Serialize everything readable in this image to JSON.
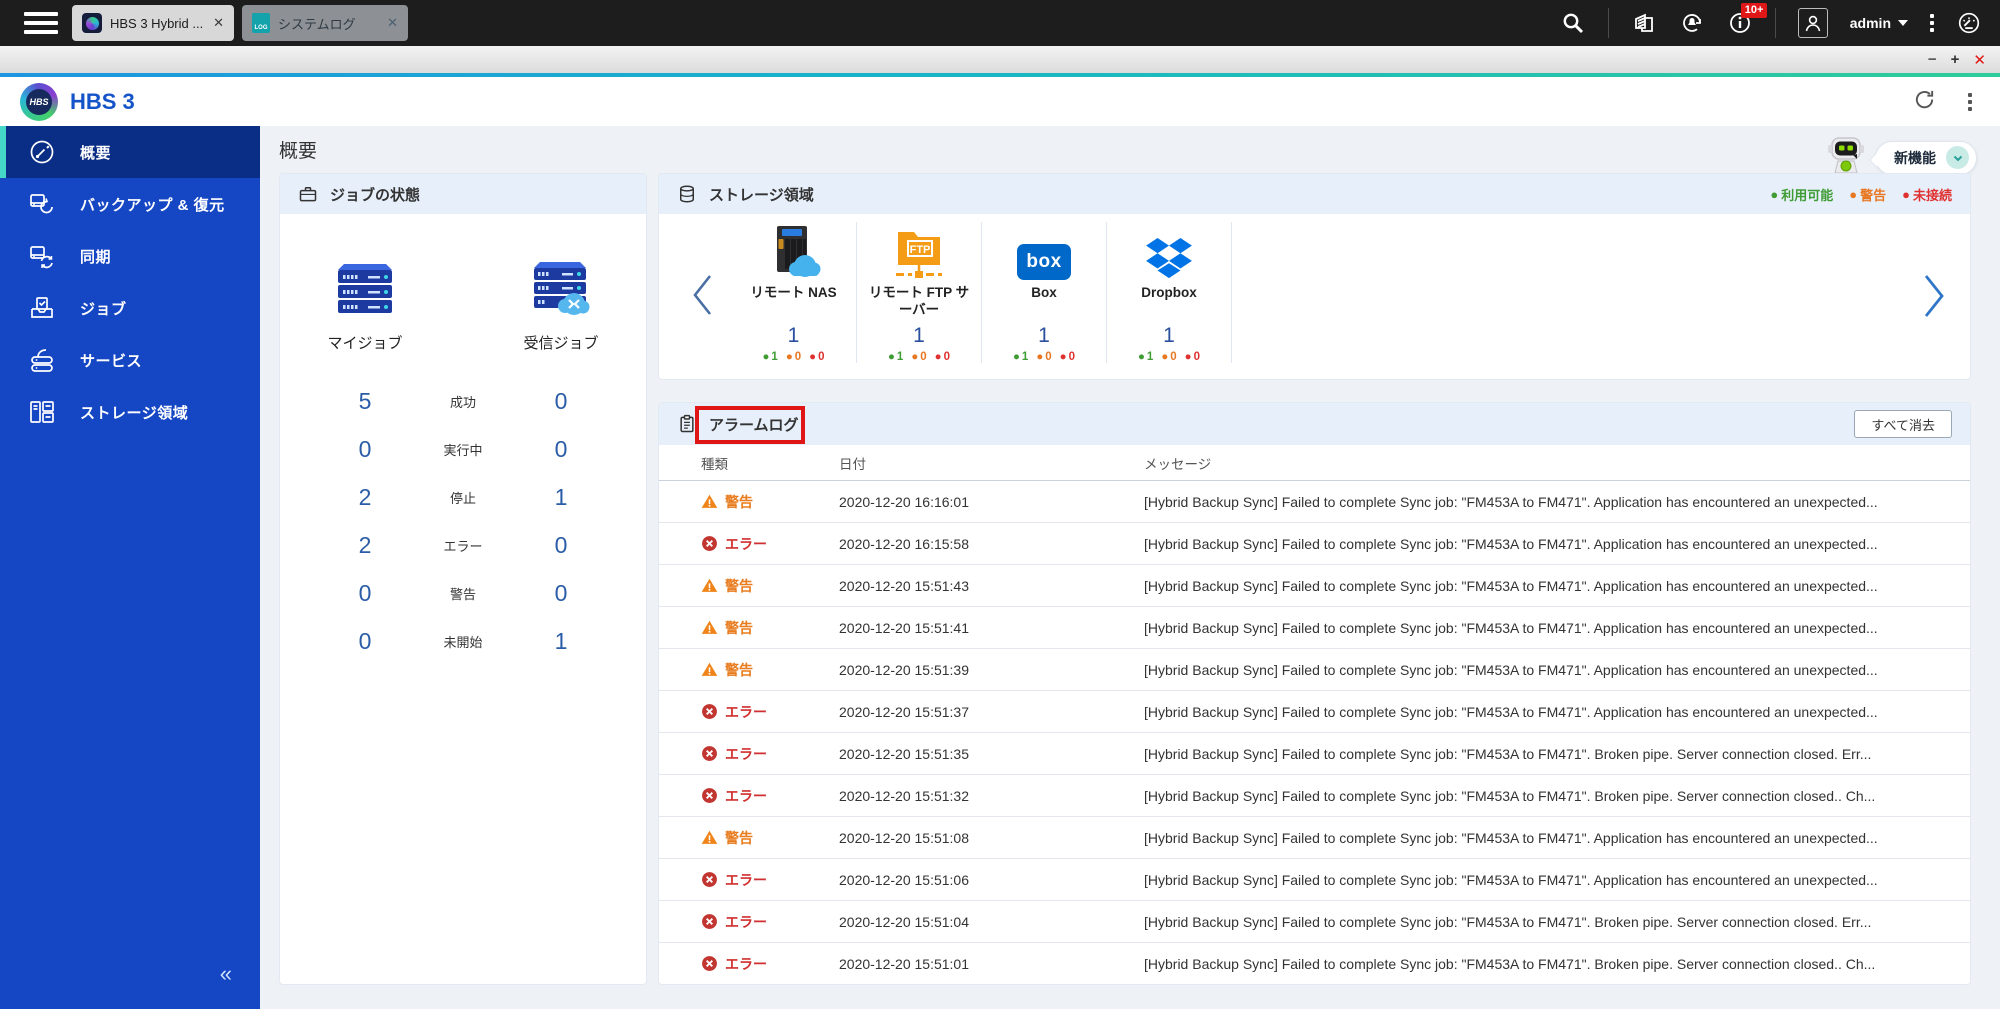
{
  "taskbar": {
    "tabs": [
      {
        "label": "HBS 3 Hybrid ...",
        "close": "✕",
        "active": true
      },
      {
        "label": "システムログ",
        "close": "✕",
        "icon_text": "LOG",
        "active": false
      }
    ],
    "notification_badge": "10+",
    "username": "admin"
  },
  "window_controls": {
    "minimize": "−",
    "maximize": "+",
    "close": "✕"
  },
  "app": {
    "title": "HBS 3",
    "logo_text": "HBS"
  },
  "sidebar": {
    "items": [
      {
        "label": "概要",
        "active": true
      },
      {
        "label": "バックアップ & 復元"
      },
      {
        "label": "同期"
      },
      {
        "label": "ジョブ"
      },
      {
        "label": "サービス"
      },
      {
        "label": "ストレージ領域"
      }
    ],
    "collapse_glyph": "«"
  },
  "page": {
    "title": "概要",
    "whats_new_label": "新機能"
  },
  "job_status_panel": {
    "title": "ジョブの状態",
    "columns": {
      "my": "マイジョブ",
      "received": "受信ジョブ"
    },
    "rows": [
      {
        "label": "成功",
        "my": "5",
        "received": "0"
      },
      {
        "label": "実行中",
        "my": "0",
        "received": "0"
      },
      {
        "label": "停止",
        "my": "2",
        "received": "1"
      },
      {
        "label": "エラー",
        "my": "2",
        "received": "0"
      },
      {
        "label": "警告",
        "my": "0",
        "received": "0"
      },
      {
        "label": "未開始",
        "my": "0",
        "received": "1"
      }
    ]
  },
  "storage_panel": {
    "title": "ストレージ領域",
    "legend": [
      {
        "label": "利用可能",
        "color": "#3f9c35"
      },
      {
        "label": "警告",
        "color": "#e87722"
      },
      {
        "label": "未接続",
        "color": "#e03131"
      }
    ],
    "items": [
      {
        "name": "リモート NAS",
        "count": "1",
        "available": "1",
        "warning": "0",
        "disconnected": "0"
      },
      {
        "name": "リモート FTP サーバー",
        "count": "1",
        "available": "1",
        "warning": "0",
        "disconnected": "0",
        "logo_text": "FTP"
      },
      {
        "name": "Box",
        "count": "1",
        "available": "1",
        "warning": "0",
        "disconnected": "0",
        "logo_text": "box"
      },
      {
        "name": "Dropbox",
        "count": "1",
        "available": "1",
        "warning": "0",
        "disconnected": "0"
      }
    ]
  },
  "alarm_panel": {
    "title": "アラームログ",
    "clear_all_label": "すべて消去",
    "columns": {
      "type": "種類",
      "date": "日付",
      "message": "メッセージ"
    },
    "severity_labels": {
      "warning": "警告",
      "error": "エラー"
    },
    "rows": [
      {
        "type": "warning",
        "date": "2020-12-20 16:16:01",
        "message": "[Hybrid Backup Sync] Failed to complete Sync job: \"FM453A to FM471\". Application has encountered an unexpected..."
      },
      {
        "type": "error",
        "date": "2020-12-20 16:15:58",
        "message": "[Hybrid Backup Sync] Failed to complete Sync job: \"FM453A to FM471\". Application has encountered an unexpected..."
      },
      {
        "type": "warning",
        "date": "2020-12-20 15:51:43",
        "message": "[Hybrid Backup Sync] Failed to complete Sync job: \"FM453A to FM471\". Application has encountered an unexpected..."
      },
      {
        "type": "warning",
        "date": "2020-12-20 15:51:41",
        "message": "[Hybrid Backup Sync] Failed to complete Sync job: \"FM453A to FM471\". Application has encountered an unexpected..."
      },
      {
        "type": "warning",
        "date": "2020-12-20 15:51:39",
        "message": "[Hybrid Backup Sync] Failed to complete Sync job: \"FM453A to FM471\". Application has encountered an unexpected..."
      },
      {
        "type": "error",
        "date": "2020-12-20 15:51:37",
        "message": "[Hybrid Backup Sync] Failed to complete Sync job: \"FM453A to FM471\". Application has encountered an unexpected..."
      },
      {
        "type": "error",
        "date": "2020-12-20 15:51:35",
        "message": "[Hybrid Backup Sync] Failed to complete Sync job: \"FM453A to FM471\". Broken pipe. Server connection closed. Err..."
      },
      {
        "type": "error",
        "date": "2020-12-20 15:51:32",
        "message": "[Hybrid Backup Sync] Failed to complete Sync job: \"FM453A to FM471\". Broken pipe. Server connection closed.. Ch..."
      },
      {
        "type": "warning",
        "date": "2020-12-20 15:51:08",
        "message": "[Hybrid Backup Sync] Failed to complete Sync job: \"FM453A to FM471\". Application has encountered an unexpected..."
      },
      {
        "type": "error",
        "date": "2020-12-20 15:51:06",
        "message": "[Hybrid Backup Sync] Failed to complete Sync job: \"FM453A to FM471\". Application has encountered an unexpected..."
      },
      {
        "type": "error",
        "date": "2020-12-20 15:51:04",
        "message": "[Hybrid Backup Sync] Failed to complete Sync job: \"FM453A to FM471\". Broken pipe. Server connection closed. Err..."
      },
      {
        "type": "error",
        "date": "2020-12-20 15:51:01",
        "message": "[Hybrid Backup Sync] Failed to complete Sync job: \"FM453A to FM471\". Broken pipe. Server connection closed.. Ch..."
      }
    ]
  },
  "colors": {
    "sidebar_blue": "#1546c3",
    "active_item": "#0a2d85",
    "accent_teal": "#45d8c8",
    "warning": "#e87c1e",
    "error": "#d03030",
    "available": "#3f9c35",
    "count_blue": "#2a4f9e"
  }
}
